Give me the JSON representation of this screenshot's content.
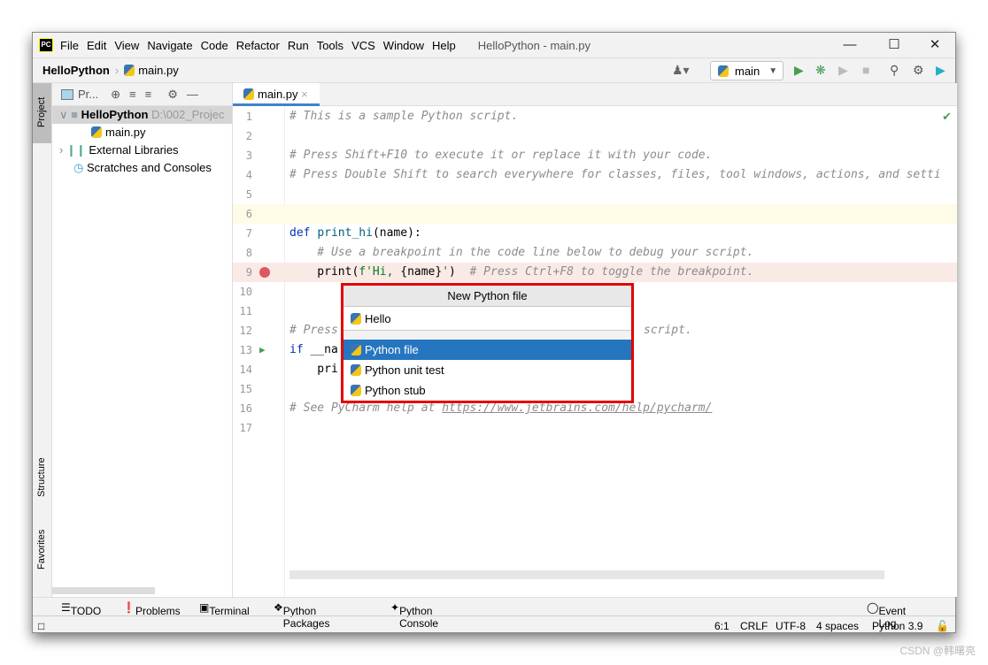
{
  "app": {
    "logo": "PC",
    "window_title": "HelloPython - main.py",
    "menu": [
      "File",
      "Edit",
      "View",
      "Navigate",
      "Code",
      "Refactor",
      "Run",
      "Tools",
      "VCS",
      "Window",
      "Help"
    ]
  },
  "toolbar": {
    "breadcrumb_project": "HelloPython",
    "breadcrumb_file": "main.py",
    "run_config": "main"
  },
  "left_stripe": {
    "project": "Project",
    "structure": "Structure",
    "favorites": "Favorites"
  },
  "project_panel": {
    "dropdown": "Pr...",
    "tree": [
      {
        "label": "HelloPython",
        "path": "D:\\002_Projec"
      },
      {
        "label": "main.py"
      },
      {
        "label": "External Libraries"
      },
      {
        "label": "Scratches and Consoles"
      }
    ]
  },
  "editor": {
    "tab": "main.py",
    "lines": [
      "# This is a sample Python script.",
      "",
      "# Press Shift+F10 to execute it or replace it with your code.",
      "# Press Double Shift to search everywhere for classes, files, tool windows, actions, and setti",
      "",
      "",
      "def print_hi(name):",
      "    # Use a breakpoint in the code line below to debug your script.",
      "    print(f'Hi, {name}')  # Press Ctrl+F8 to toggle the breakpoint.",
      "",
      "",
      "# Press",
      "if __na",
      "    pri",
      "",
      "# See PyCharm help at https://www.jetbrains.com/help/pycharm/",
      ""
    ],
    "line12_tail": "script."
  },
  "popup": {
    "title": "New Python file",
    "input_value": "Hello",
    "options": [
      "Python file",
      "Python unit test",
      "Python stub"
    ],
    "selected": "Python file"
  },
  "bottom_tools": [
    "TODO",
    "Problems",
    "Terminal",
    "Python Packages",
    "Python Console",
    "Event Log"
  ],
  "status": {
    "position": "6:1",
    "line_sep": "CRLF",
    "encoding": "UTF-8",
    "indent": "4 spaces",
    "interpreter": "Python 3.9"
  },
  "watermark": "CSDN @韩曙亮",
  "colors": {
    "selection": "#2675bf",
    "highlight_border": "#e30000",
    "breakpoint": "#db5860",
    "run": "#499c54"
  }
}
